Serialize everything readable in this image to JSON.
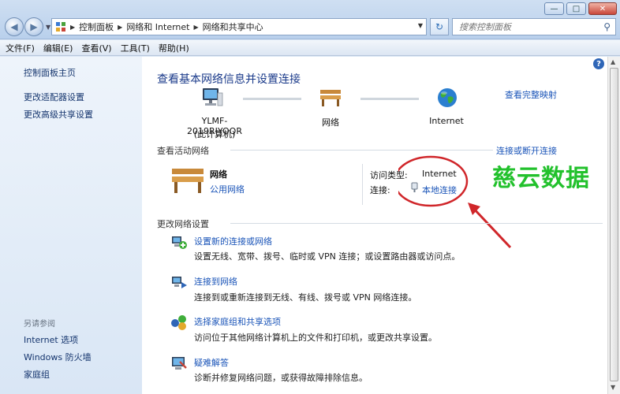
{
  "address": {
    "crumbs": [
      "控制面板",
      "网络和 Internet",
      "网络和共享中心"
    ]
  },
  "search": {
    "placeholder": "搜索控制面板"
  },
  "menu": [
    "文件(F)",
    "编辑(E)",
    "查看(V)",
    "工具(T)",
    "帮助(H)"
  ],
  "sidebar": {
    "links": [
      "控制面板主页",
      "更改适配器设置",
      "更改高级共享设置"
    ],
    "see_also_heading": "另请参阅",
    "see_also": [
      "Internet 选项",
      "Windows 防火墙",
      "家庭组"
    ]
  },
  "main": {
    "title": "查看基本网络信息并设置连接",
    "full_map": "查看完整映射",
    "nodes": {
      "computer_name": "YLMF-2019RIYOQR",
      "computer_sub": "(此计算机)",
      "network": "网络",
      "internet": "Internet"
    },
    "active_heading": "查看活动网络",
    "connect_link": "连接或断开连接",
    "active_network": {
      "name": "网络",
      "category": "公用网络",
      "access_type_label": "访问类型:",
      "access_type_value": "Internet",
      "connections_label": "连接:",
      "connections_value": "本地连接"
    },
    "change_heading": "更改网络设置",
    "tasks": [
      {
        "title": "设置新的连接或网络",
        "desc": "设置无线、宽带、拨号、临时或 VPN 连接；或设置路由器或访问点。",
        "icon": "new-connection-icon"
      },
      {
        "title": "连接到网络",
        "desc": "连接到或重新连接到无线、有线、拨号或 VPN 网络连接。",
        "icon": "connect-network-icon"
      },
      {
        "title": "选择家庭组和共享选项",
        "desc": "访问位于其他网络计算机上的文件和打印机，或更改共享设置。",
        "icon": "homegroup-icon"
      },
      {
        "title": "疑难解答",
        "desc": "诊断并修复网络问题，或获得故障排除信息。",
        "icon": "troubleshoot-icon"
      }
    ]
  },
  "watermark": "慈云数据",
  "colors": {
    "link": "#1a54b8",
    "title": "#1a3a8a",
    "annotation": "#d0262a",
    "watermark": "#22c12c"
  }
}
